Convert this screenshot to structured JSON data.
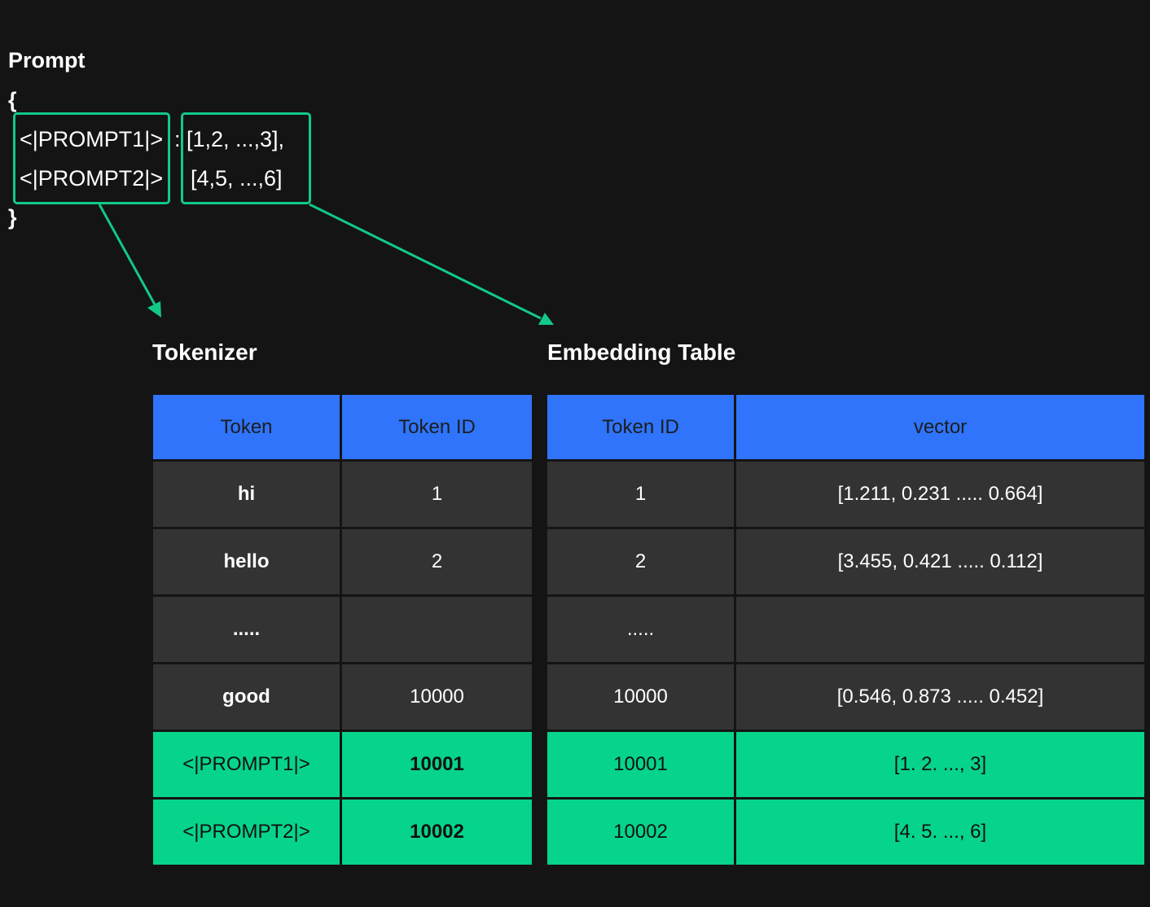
{
  "prompt": {
    "title": "Prompt",
    "open_brace": "{",
    "close_brace": "}",
    "lines": [
      {
        "key": "<|PROMPT1|>",
        "sep": ":",
        "value": "[1,2, ...,3],"
      },
      {
        "key": "<|PROMPT2|>",
        "sep": ":",
        "value": "[4,5, ...,6]"
      }
    ]
  },
  "tokenizer": {
    "title": "Tokenizer",
    "headers": [
      "Token",
      "Token ID"
    ],
    "rows": [
      {
        "token": "hi",
        "id": "1",
        "highlight": false
      },
      {
        "token": "hello",
        "id": "2",
        "highlight": false
      },
      {
        "token": ".....",
        "id": "",
        "highlight": false
      },
      {
        "token": "good",
        "id": "10000",
        "highlight": false
      },
      {
        "token": "<|PROMPT1|>",
        "id": "10001",
        "highlight": true
      },
      {
        "token": "<|PROMPT2|>",
        "id": "10002",
        "highlight": true
      }
    ]
  },
  "embedding": {
    "title": "Embedding Table",
    "headers": [
      "Token ID",
      "vector"
    ],
    "rows": [
      {
        "id": "1",
        "vector": "[1.211, 0.231 ..... 0.664]",
        "highlight": false
      },
      {
        "id": "2",
        "vector": "[3.455, 0.421 ..... 0.112]",
        "highlight": false
      },
      {
        "id": ".....",
        "vector": "",
        "highlight": false
      },
      {
        "id": "10000",
        "vector": "[0.546, 0.873 ..... 0.452]",
        "highlight": false
      },
      {
        "id": "10001",
        "vector": "[1. 2. ..., 3]",
        "highlight": true
      },
      {
        "id": "10002",
        "vector": "[4. 5. ..., 6]",
        "highlight": true
      }
    ]
  },
  "colors": {
    "background": "#141414",
    "header_blue": "#2f74fb",
    "cell_gray": "#333333",
    "highlight_green": "#06d48a",
    "arrow_green": "#12c987"
  }
}
